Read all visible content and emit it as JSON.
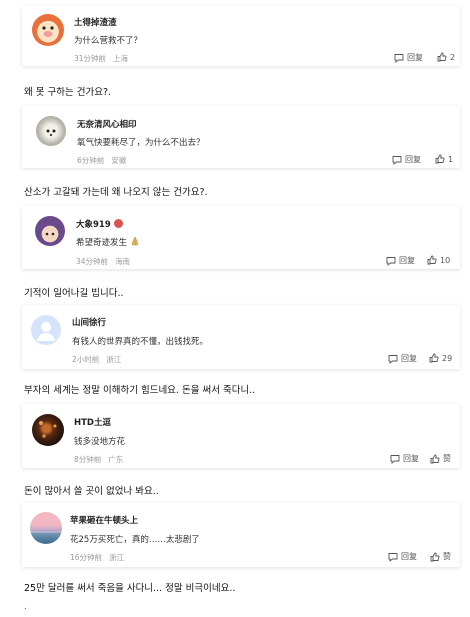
{
  "comments": [
    {
      "user": "土得掉渣渣",
      "text": "为什么营救不了？",
      "time": "31分钟前",
      "location": "上海",
      "reply_label": "回复",
      "likes": "2",
      "translation": "왜 못 구하는 건가요?."
    },
    {
      "user": "无奈清风心相印",
      "text": "氧气快要耗尽了，为什么不出去？",
      "time": "6分钟前",
      "location": "安徽",
      "reply_label": "回复",
      "likes": "1",
      "translation": "산소가 고갈돼 가는데 왜 나오지 않는 건가요?."
    },
    {
      "user": "大象919",
      "text": "希望奇迹发生",
      "time": "34分钟前",
      "location": "海南",
      "reply_label": "回复",
      "likes": "10",
      "translation": "기적이 일어나길 빕니다.."
    },
    {
      "user": "山间徐行",
      "text": "有钱人的世界真的不懂，出钱找死。",
      "time": "2小时前",
      "location": "浙江",
      "reply_label": "回复",
      "likes": "29",
      "translation": "부자의 세계는 정말 이해하기 힘드네요. 돈을 써서 죽다니.."
    },
    {
      "user": "HTD土逗",
      "text": "钱多没地方花",
      "time": "8分钟前",
      "location": "广东",
      "reply_label": "回复",
      "likes": "赞",
      "translation": "돈이 많아서 쓸 곳이 없었나 봐요.."
    },
    {
      "user": "苹果砸在牛顿头上",
      "text": "花25万买死亡，真的……太悲剧了",
      "time": "16分钟前",
      "location": "浙江",
      "reply_label": "回复",
      "likes": "赞",
      "translation": "25만 달러를 써서 죽음을 사다니... 정말 비극이네요.."
    }
  ],
  "trailing_mark": ".",
  "icons": {
    "reply": "comment-bubble-icon",
    "like": "thumbs-up-icon",
    "badge": "level-badge-icon",
    "emoji": "praying-hands-icon"
  },
  "colors": {
    "meta": "#9a9a9a",
    "badge": "#d9534f"
  }
}
